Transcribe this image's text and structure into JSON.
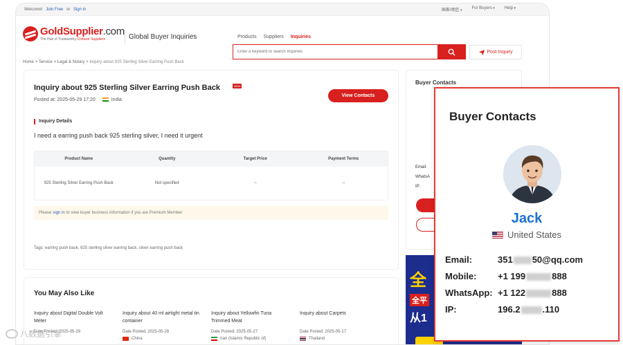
{
  "topbar": {
    "welcome": "Welcome!",
    "join": "Join Free",
    "or": "or",
    "signin": "Sign in",
    "menu1": "国家/地区",
    "menu2": "For Buyers",
    "menu3": "Help"
  },
  "header": {
    "logo_name": "GoldSupplier",
    "logo_domain": ".com",
    "logo_tag_prefix": "The Hub of Trustworthy",
    "logo_tag_red": "Chinese Suppliers",
    "title": "Global Buyer Inquiries",
    "search_tabs": [
      "Products",
      "Suppliers",
      "Inquiries"
    ],
    "search_placeholder": "Enter a keyword to search Inquiries",
    "post_inquiry": "Post Inquiry"
  },
  "breadcrumb": {
    "items": [
      "Home",
      "Service",
      "Legal & Notary"
    ],
    "separator": ">",
    "current": "Inquiry about 925 Sterling Silver Earring Push Back"
  },
  "inquiry": {
    "title": "Inquiry about 925 Sterling Silver Earring Push Back",
    "badge": "NEW",
    "posted": "Posted at: 2025-05-29 17:20",
    "country": "India",
    "view_contacts": "View Contacts",
    "details_label": "Inquiry Details",
    "text": "I need a earring push back 925 sterling silver, I need it urgent",
    "table_headers": [
      "Product Name",
      "Quantity",
      "Target Price",
      "Payment Terms"
    ],
    "table_row": [
      "925 Sterling Silver Earring Push Back",
      "Not specified",
      "--",
      "--"
    ],
    "notice_prefix": "Please",
    "notice_link": "sign in",
    "notice_suffix": "to view buyer business information if you are Premium Member",
    "tags": "Tags: earring push back,  925 sterling silver earring back,  silver earring push back"
  },
  "right_card": {
    "title": "Buyer Contacts",
    "labels": [
      "Email:",
      "WhatsA",
      "IP:"
    ]
  },
  "ad": {
    "line1": "全",
    "line2": "全平",
    "line3": "从1"
  },
  "also": {
    "title": "You May Also Like",
    "items": [
      {
        "title": "Inquiry about Digital Double Volt Meter",
        "date": "Date Posted: 2025-05-29",
        "country": ""
      },
      {
        "title": "Inquiry about 40 ml airtight metal tin container",
        "date": "Date Posted: 2025-05-28",
        "country": "China"
      },
      {
        "title": "Inquiry about Yellowfin Tuna Trimmed Meat",
        "date": "Date Posted: 2025-05-27",
        "country": "Iran (Islamic Republic of)"
      },
      {
        "title": "Inquiry about Carpets",
        "date": "Date Posted: 2025-05-17",
        "country": "Thailand"
      }
    ]
  },
  "zoom": {
    "title": "Buyer Contacts",
    "name": "Jack",
    "country": "United States",
    "email_label": "Email:",
    "email_prefix": "351",
    "email_suffix": "50@qq.com",
    "mobile_label": "Mobile:",
    "mobile_prefix": "+1 199",
    "mobile_suffix": "888",
    "whatsapp_label": "WhatsApp:",
    "whatsapp_prefix": "+1 122",
    "whatsapp_suffix": "888",
    "ip_label": "IP:",
    "ip_prefix": "196.2",
    "ip_suffix": ".110"
  },
  "watermark": "八数据引擎"
}
